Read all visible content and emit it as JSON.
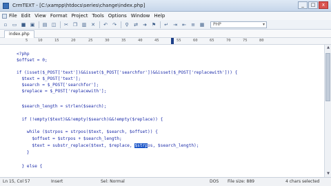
{
  "window": {
    "title": "CrmTEXT - [C:\\xampp\\htdocs\\series\\change\\index.php]",
    "controls": [
      "_",
      "□",
      "x"
    ]
  },
  "menu": [
    "File",
    "Edit",
    "View",
    "Format",
    "Project",
    "Tools",
    "Options",
    "Window",
    "Help"
  ],
  "toolbar": {
    "language": "PHP"
  },
  "tabs": [
    "index.php"
  ],
  "ruler": [
    "5",
    "10",
    "15",
    "20",
    "25",
    "30",
    "35",
    "40",
    "45",
    "50",
    "55",
    "60",
    "65",
    "70",
    "75",
    "80"
  ],
  "code": {
    "lines": [
      "<?php",
      "$offset = 0;",
      "",
      "if (isset($_POST['text'])&&isset($_POST['searchfor'])&&isset($_POST['replacewith'])) {",
      "  $text = $_POST['text'];",
      "  $search = $_POST['searchfor'];",
      "  $replace = $_POST['replacewith'];",
      "",
      "  $search_length = strlen($search);",
      "",
      "  if (!empty($text)&&!empty($search)&&!empty($replace)) {",
      "",
      "    while ($strpos = strpos($text, $search, $offset)) {",
      "      $offset = $strpos + $search_length;",
      "      $text = substr_replace($text, $replace, ",
      "    }",
      "",
      "  } else {"
    ],
    "line15_selected": "$strp",
    "line15_rest": "os, $search_length);"
  },
  "status": {
    "position": "Ln 15, Col 57",
    "mode": "Insert",
    "selection": "Sel: Normal",
    "encoding": "DOS",
    "file_size": "File size: 889",
    "selected_count": "4 chars selected"
  }
}
